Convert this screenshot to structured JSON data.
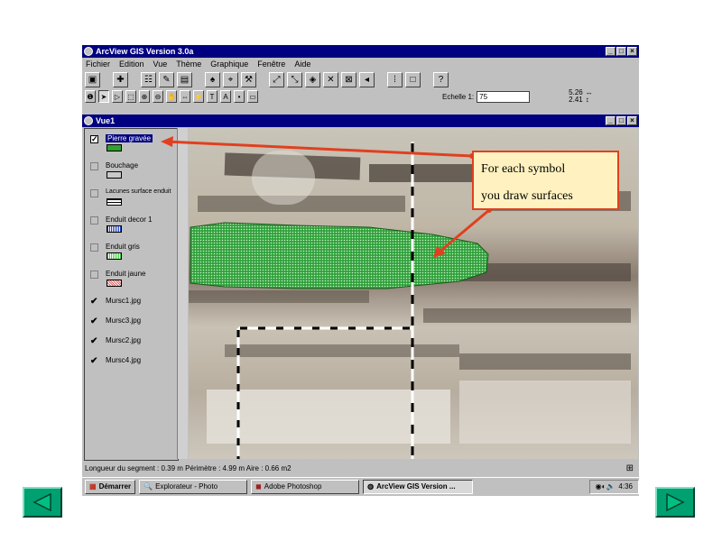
{
  "app": {
    "title": "ArcView GIS Version 3.0a",
    "menu": [
      "Fichier",
      "Edition",
      "Vue",
      "Thème",
      "Graphique",
      "Fenêtre",
      "Aide"
    ],
    "scale_label": "Echelle 1:",
    "scale_value": "75",
    "coord_x": "5.26",
    "coord_y": "2.41"
  },
  "view": {
    "title": "Vue1",
    "legend": [
      {
        "label": "Pierre gravée",
        "checked": true,
        "swatch": "#30a030"
      },
      {
        "label": "Bouchage",
        "checked": false,
        "swatch": "#c8c8c8"
      },
      {
        "label": "Lacunes surface enduit",
        "checked": false,
        "swatch": "#ffffff"
      },
      {
        "label": "Enduit decor 1",
        "checked": false,
        "swatch": "#2040c0"
      },
      {
        "label": "Enduit gris",
        "checked": false,
        "swatch": "#40d040"
      },
      {
        "label": "Enduit jaune",
        "checked": false,
        "swatch": "#e06060"
      },
      {
        "label": "Mursc1.jpg",
        "checked": true
      },
      {
        "label": "Mursc3.jpg",
        "checked": true
      },
      {
        "label": "Mursc2.jpg",
        "checked": true
      },
      {
        "label": "Mursc4.jpg",
        "checked": true
      }
    ]
  },
  "status": "Longueur du segment : 0.39 m  Périmètre : 4.99 m  Aire : 0.66 m2",
  "taskbar": {
    "start": "Démarrer",
    "tasks": [
      "Explorateur - Photo",
      "Adobe Photoshop",
      "ArcView GIS Version ..."
    ],
    "time": "4:36"
  },
  "callout": {
    "line1": "For each symbol",
    "line2": "you draw surfaces"
  },
  "colors": {
    "titlebar": "#000080",
    "arrow": "#e04020",
    "callout_bg": "#fff2c0",
    "nav_button": "#00a070"
  }
}
